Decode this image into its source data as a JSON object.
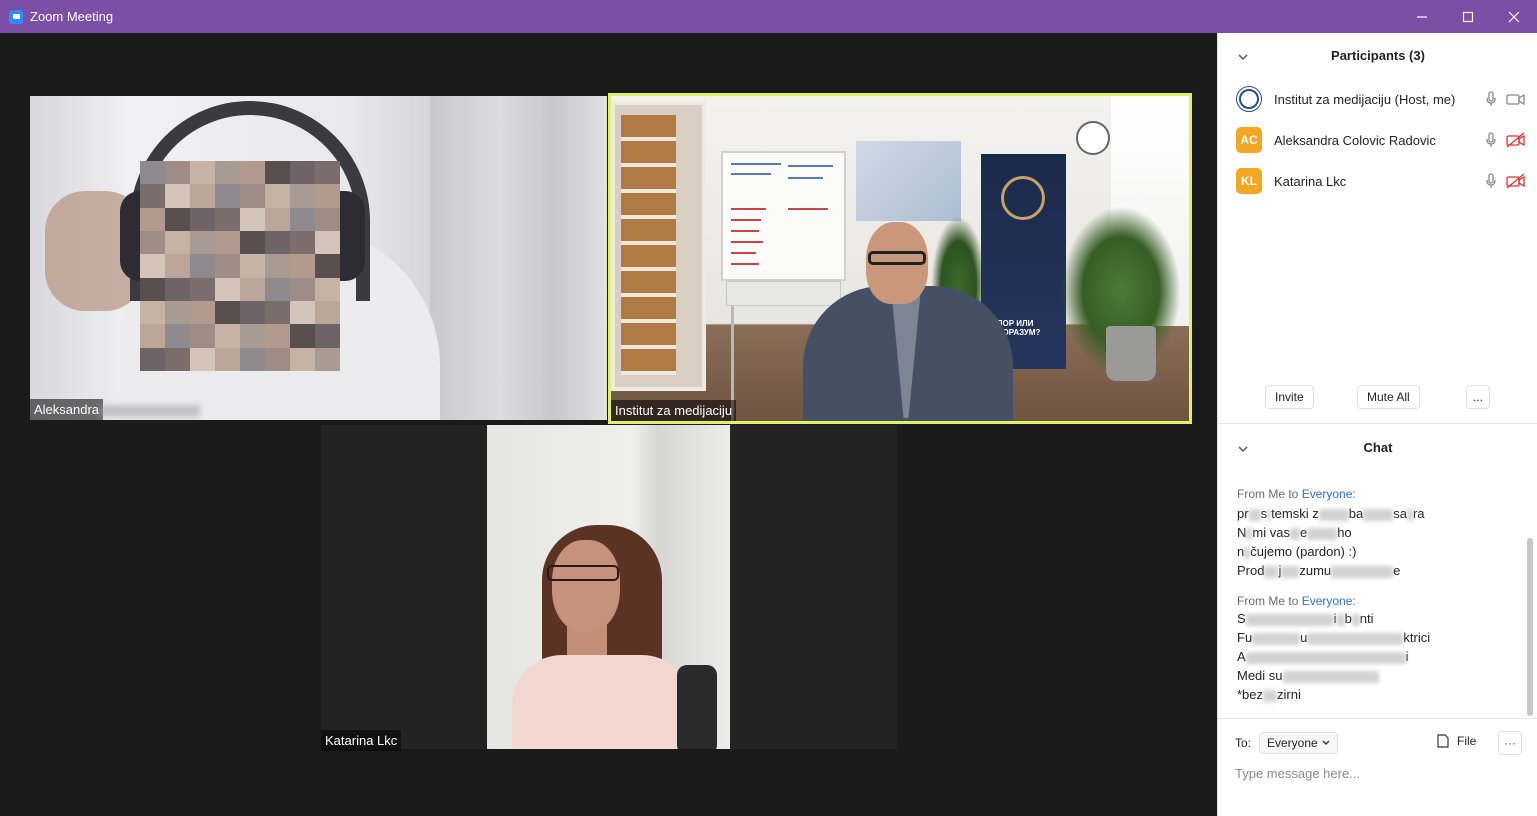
{
  "window": {
    "title": "Zoom Meeting"
  },
  "videos": {
    "tile1_name": "Aleksandra",
    "tile2_name": "Institut za medijaciju",
    "tile3_name": "Katarina Lkc",
    "banner_text": "СПОР ИЛИ СПОРАЗУМ?"
  },
  "participants": {
    "header": "Participants (3)",
    "items": [
      {
        "name": "Institut za medijaciju (Host, me)",
        "initials": ""
      },
      {
        "name": "Aleksandra Colovic Radovic",
        "initials": "AC"
      },
      {
        "name": "Katarina Lkc",
        "initials": "KL"
      }
    ],
    "invite_label": "Invite",
    "mute_all_label": "Mute All",
    "more_label": "..."
  },
  "chat": {
    "header": "Chat",
    "messages": [
      {
        "from": "From Me to ",
        "to": "Everyone:",
        "lines": [
          "pr",
          "s",
          "temski z",
          "ba",
          "sa",
          "ra",
          "N",
          "mi vas",
          "e",
          "ho",
          "n",
          "čujemo (pardon) :)",
          "Prod",
          "j",
          "zumu",
          "e"
        ]
      },
      {
        "from": "From Me to ",
        "to": "Everyone:",
        "lines": [
          "S",
          "i",
          "b",
          "nti",
          "Fu",
          "u",
          "ktrici",
          "A",
          "i",
          "Medi su",
          "*bez",
          "zirni"
        ]
      }
    ],
    "to_label": "To:",
    "to_value": "Everyone",
    "file_label": "File",
    "more_label": "···",
    "input_placeholder": "Type message here..."
  },
  "colors": {
    "titlebar": "#7b4fa6",
    "active_speaker_border": "#e0f06b",
    "avatar": "#f5a623",
    "link_blue": "#2d6fce"
  }
}
